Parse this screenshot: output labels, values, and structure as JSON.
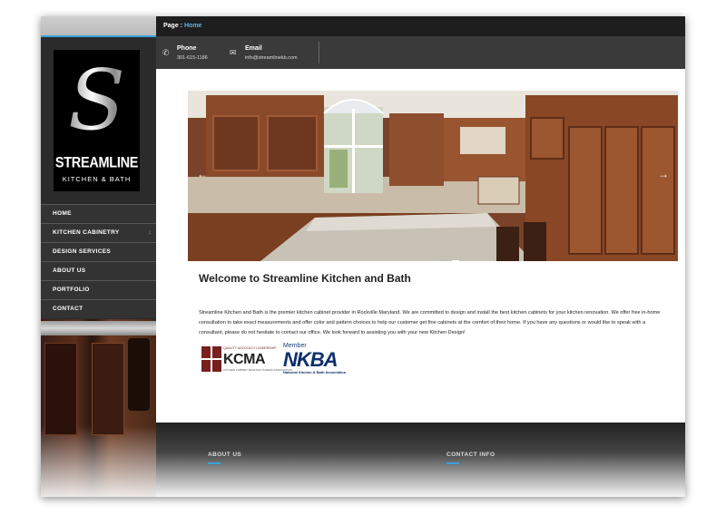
{
  "breadcrumb": {
    "label": "Page :",
    "current": "Home"
  },
  "contact": {
    "phone_label": "Phone",
    "phone_value": "301-615-1186",
    "email_label": "Email",
    "email_value": "info@streamlinekb.com"
  },
  "logo": {
    "name": "STREAMLINE",
    "tagline": "KITCHEN & BATH"
  },
  "nav": {
    "items": [
      {
        "label": "HOME"
      },
      {
        "label": "KITCHEN CABINETRY",
        "icon": "chevron-down-icon"
      },
      {
        "label": "DESIGN SERVICES"
      },
      {
        "label": "ABOUT US"
      },
      {
        "label": "PORTFOLIO"
      },
      {
        "label": "CONTACT"
      }
    ]
  },
  "slider": {
    "prev": "←",
    "next": "→",
    "slides": 2,
    "active": 2
  },
  "main": {
    "title": "Welcome to Streamline Kitchen and Bath",
    "intro": "Streamline Kitchen and Bath is the premier kitchen cabinet provider in Rockville Maryland. We are committed to design and install the best kitchen cabinets for your kitchen renovation. We offer free in-home consultation to take exact measurements and offer color and pattern choices to help our customer get fine cabinets at the comfort of their home. If you have any questions or would like to speak with a consultant, please do not hesitate to contact our office. We look forward to assisting you with your new Kitchen Design!"
  },
  "badges": {
    "kcma": {
      "top": "QUALITY ADVOCACY LEADERSHIP",
      "name": "KCMA",
      "bottom": "KITCHEN CABINET MANUFACTURERS ASSOCIATION"
    },
    "nkba": {
      "member": "Member",
      "name": "NKBA",
      "sub": "National Kitchen & Bath Association"
    }
  },
  "footer": {
    "about_heading": "ABOUT US",
    "contact_heading": "CONTACT INFO"
  },
  "colors": {
    "accent": "#3aa3d8",
    "sidebar": "#2b2b2b",
    "topbar": "#1e1e1e",
    "contactbar": "#3a3a3a"
  }
}
